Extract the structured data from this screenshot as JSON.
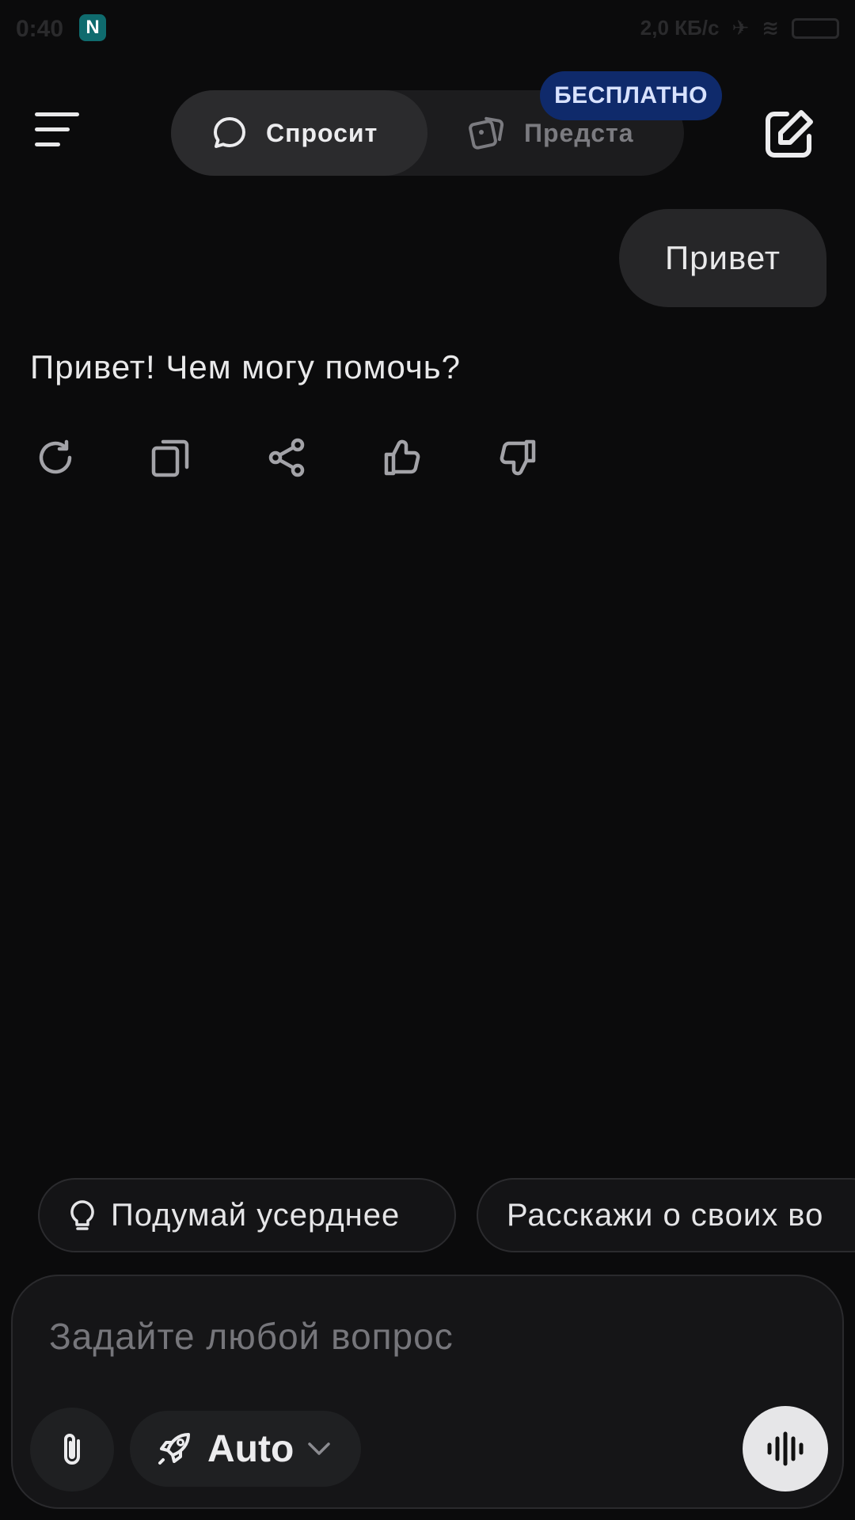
{
  "status_bar": {
    "time": "0:40",
    "app_letter": "N",
    "network_speed": "2,0 КБ/с"
  },
  "header": {
    "modes": [
      {
        "label": "Спросит",
        "icon": "chat-bubble-icon",
        "active": true
      },
      {
        "label": "Предста",
        "icon": "cards-icon",
        "active": false
      }
    ],
    "badge": "БЕСПЛАТНО"
  },
  "chat": {
    "user_message": "Привет",
    "assistant_message": "Привет! Чем могу помочь?",
    "actions": [
      "refresh-icon",
      "copy-icon",
      "share-icon",
      "thumbs-up-icon",
      "thumbs-down-icon"
    ]
  },
  "suggestions": [
    {
      "label": "Подумай усерднее",
      "icon": "lightbulb-icon"
    },
    {
      "label": "Расскажи о своих во"
    }
  ],
  "composer": {
    "placeholder": "Задайте любой вопрос",
    "model": "Auto"
  },
  "colors": {
    "background": "#0b0b0c",
    "badge": "#0f2a6b",
    "bubble": "#262628"
  }
}
